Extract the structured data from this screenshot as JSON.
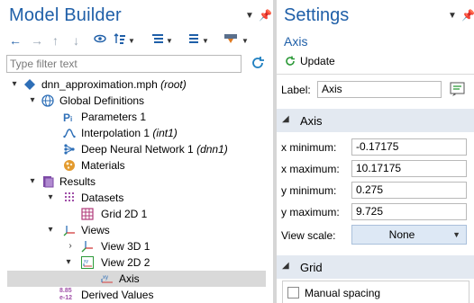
{
  "left": {
    "title": "Model Builder",
    "filter_placeholder": "Type filter text"
  },
  "tree": {
    "root": {
      "name": "dnn_approximation.mph",
      "tag": "(root)"
    },
    "global_definitions": "Global Definitions",
    "parameters": "Parameters 1",
    "interpolation": {
      "name": "Interpolation 1",
      "tag": "(int1)"
    },
    "dnn": {
      "name": "Deep Neural Network 1",
      "tag": "(dnn1)"
    },
    "materials": "Materials",
    "results": "Results",
    "datasets": "Datasets",
    "grid2d": "Grid 2D 1",
    "views": "Views",
    "view3d": "View 3D 1",
    "view2d": "View 2D 2",
    "axis": "Axis",
    "derived_values": "Derived Values",
    "derived_icon_text": {
      "top": "8.85",
      "bottom": "e-12"
    }
  },
  "settings": {
    "title": "Settings",
    "subtitle": "Axis",
    "update_label": "Update",
    "label_caption": "Label:",
    "label_value": "Axis",
    "axis_section": "Axis",
    "x_min_label": "x minimum:",
    "x_min": "-0.17175",
    "x_max_label": "x maximum:",
    "x_max": "10.17175",
    "y_min_label": "y minimum:",
    "y_min": "0.275",
    "y_max_label": "y maximum:",
    "y_max": "9.725",
    "view_scale_label": "View scale:",
    "view_scale": "None",
    "grid_section": "Grid",
    "manual_spacing": "Manual spacing"
  },
  "colors": {
    "title_blue": "#1f5fa8",
    "section_bg": "#e3e9f1",
    "selected_row": "#d9d9d9",
    "dropdown_bg": "#dde8f5"
  }
}
